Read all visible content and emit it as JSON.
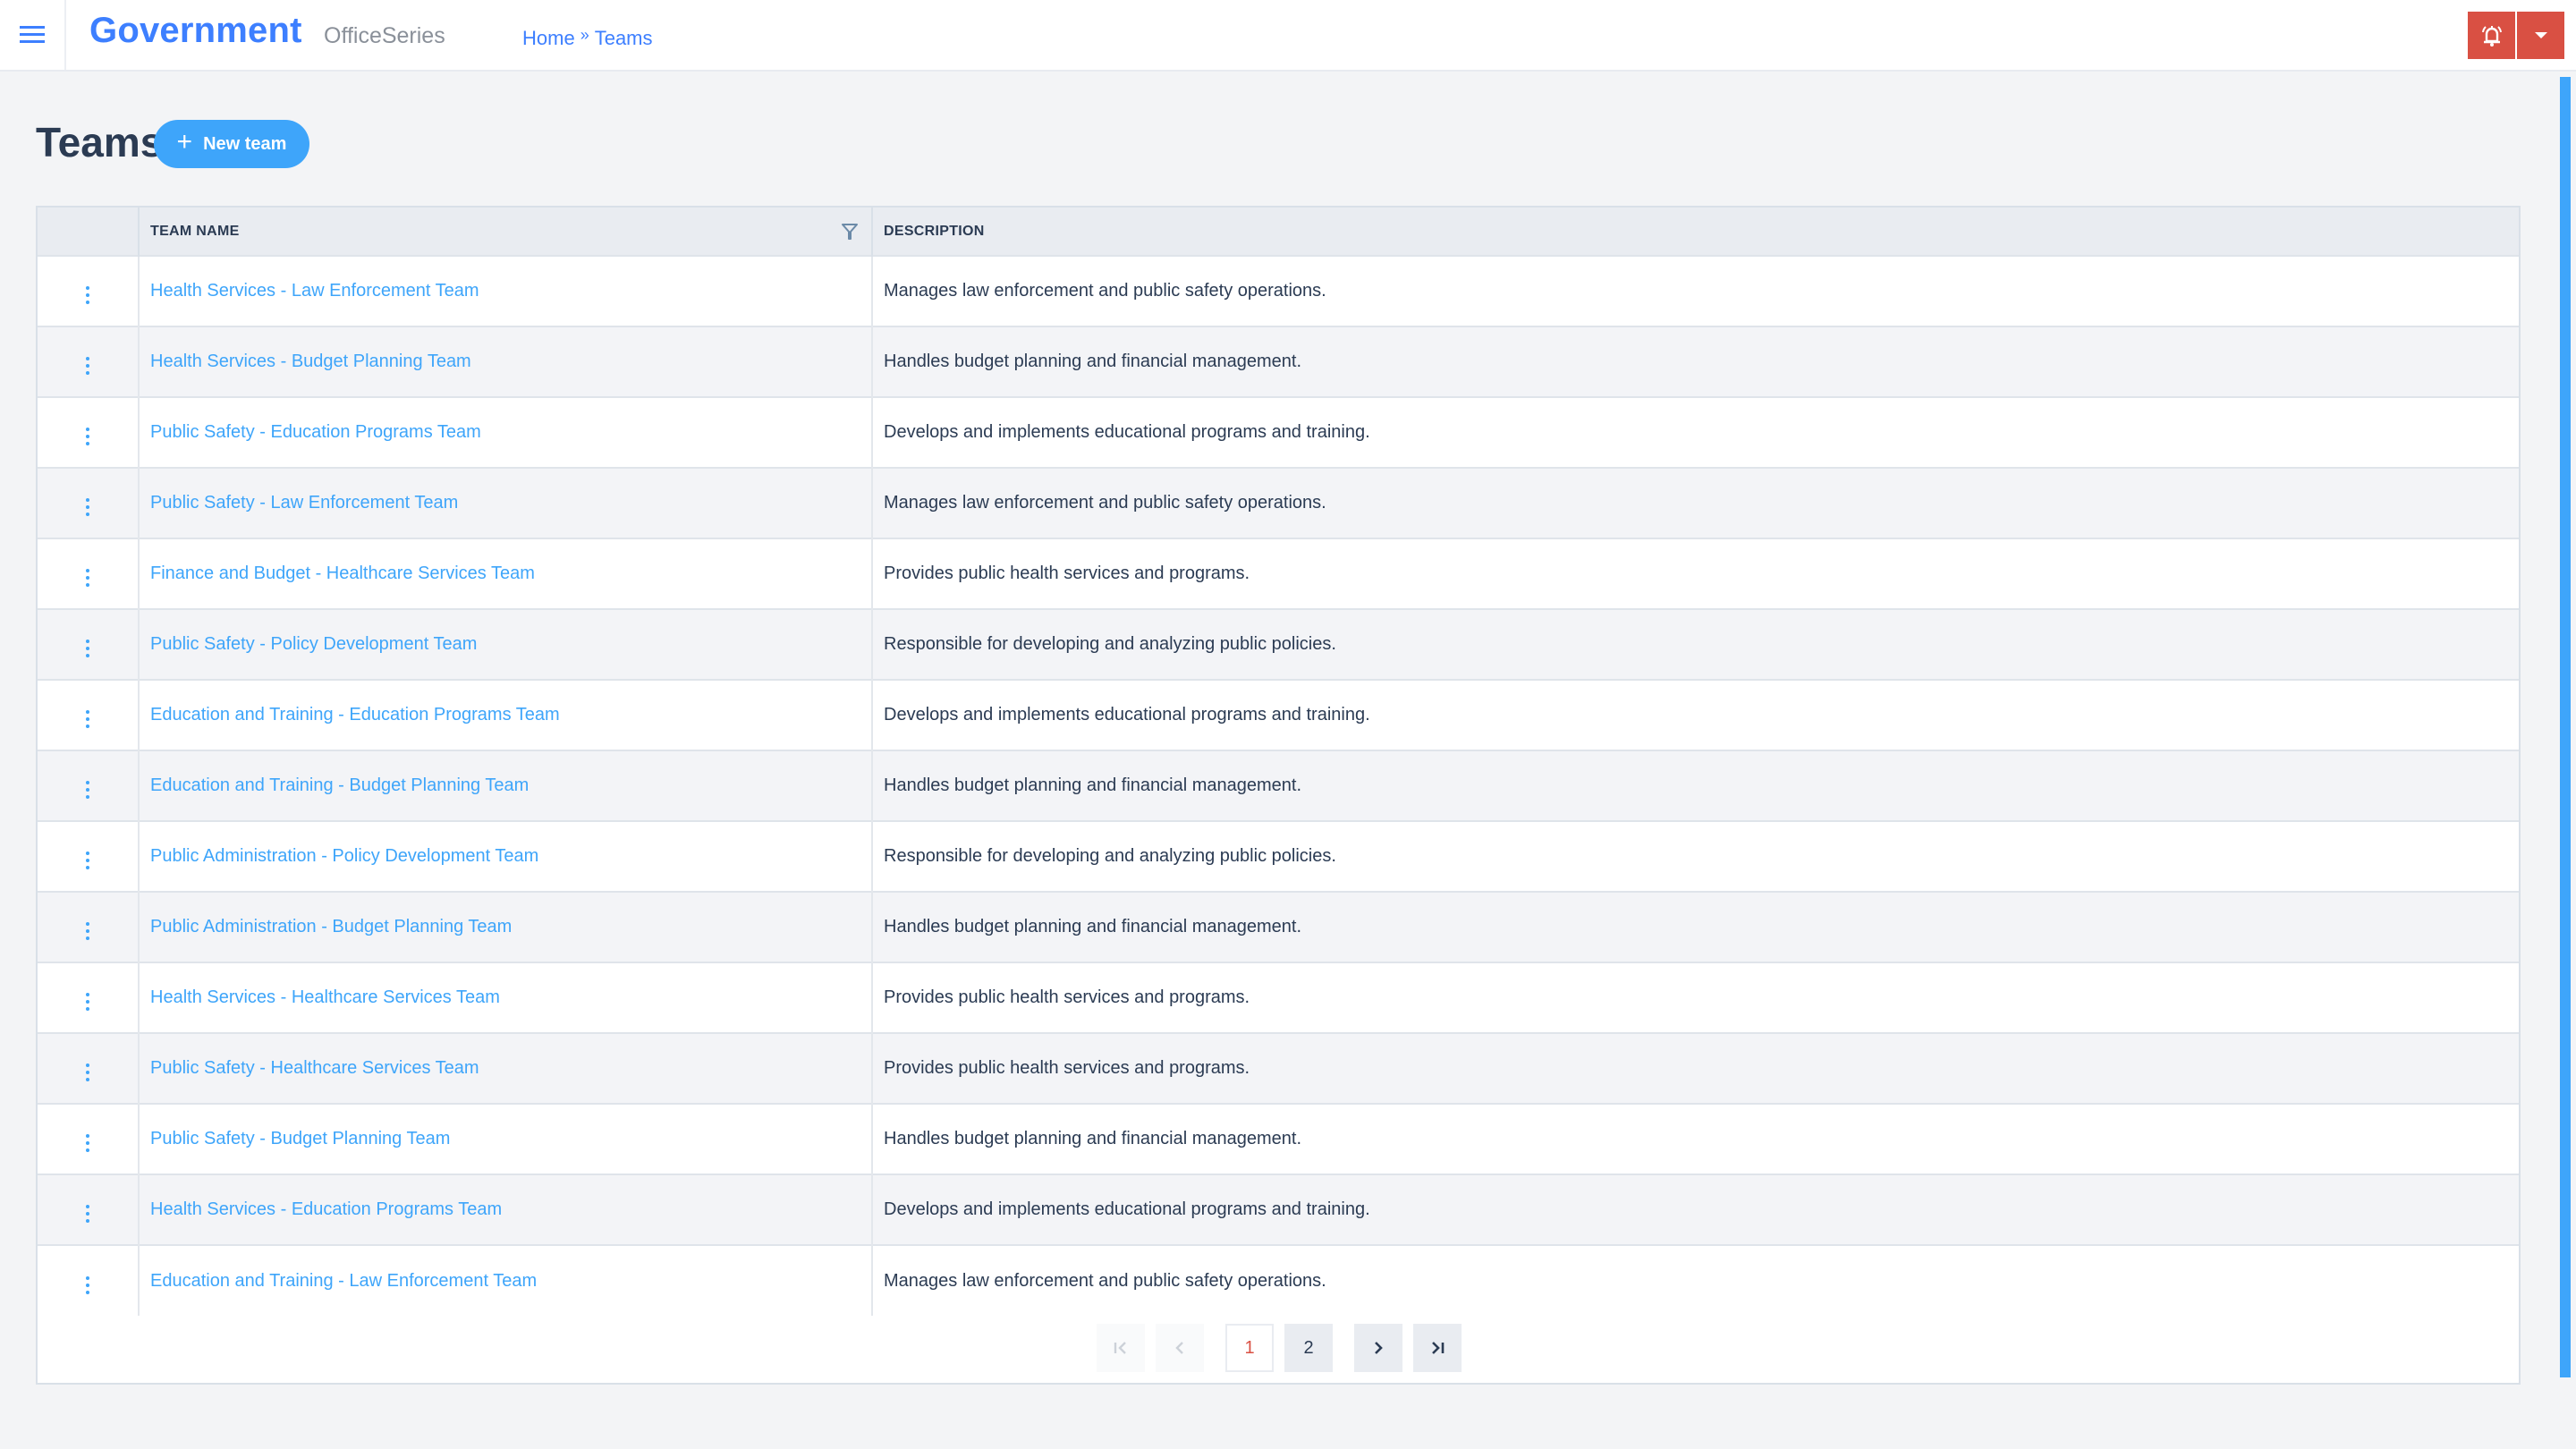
{
  "header": {
    "brand": "Government",
    "product": "OfficeSeries",
    "breadcrumb": [
      {
        "label": "Home"
      },
      {
        "label": "Teams"
      }
    ],
    "breadcrumb_separator": "»",
    "icons": {
      "menu": "hamburger-menu-icon",
      "alert": "bell-ringing-icon",
      "dropdown": "caret-down-icon"
    },
    "accent_color": "#3d7fff",
    "alert_color": "#d95043"
  },
  "page": {
    "title": "Teams",
    "new_button": {
      "label": "New team",
      "icon": "plus-icon"
    }
  },
  "table": {
    "columns": [
      {
        "key": "actions",
        "label": ""
      },
      {
        "key": "name",
        "label": "TEAM NAME",
        "filterable": true
      },
      {
        "key": "description",
        "label": "DESCRIPTION"
      }
    ],
    "rows": [
      {
        "name": "Health Services - Law Enforcement Team",
        "description": "Manages law enforcement and public safety operations."
      },
      {
        "name": "Health Services - Budget Planning Team",
        "description": "Handles budget planning and financial management."
      },
      {
        "name": "Public Safety - Education Programs Team",
        "description": "Develops and implements educational programs and training."
      },
      {
        "name": "Public Safety - Law Enforcement Team",
        "description": "Manages law enforcement and public safety operations."
      },
      {
        "name": "Finance and Budget - Healthcare Services Team",
        "description": "Provides public health services and programs."
      },
      {
        "name": "Public Safety - Policy Development Team",
        "description": "Responsible for developing and analyzing public policies."
      },
      {
        "name": "Education and Training - Education Programs Team",
        "description": "Develops and implements educational programs and training."
      },
      {
        "name": "Education and Training - Budget Planning Team",
        "description": "Handles budget planning and financial management."
      },
      {
        "name": "Public Administration - Policy Development Team",
        "description": "Responsible for developing and analyzing public policies."
      },
      {
        "name": "Public Administration - Budget Planning Team",
        "description": "Handles budget planning and financial management."
      },
      {
        "name": "Health Services - Healthcare Services Team",
        "description": "Provides public health services and programs."
      },
      {
        "name": "Public Safety - Healthcare Services Team",
        "description": "Provides public health services and programs."
      },
      {
        "name": "Public Safety - Budget Planning Team",
        "description": "Handles budget planning and financial management."
      },
      {
        "name": "Health Services - Education Programs Team",
        "description": "Develops and implements educational programs and training."
      },
      {
        "name": "Education and Training - Law Enforcement Team",
        "description": "Manages law enforcement and public safety operations."
      }
    ]
  },
  "pagination": {
    "first": {
      "glyph": "|<",
      "disabled": true
    },
    "prev": {
      "glyph": "<",
      "disabled": true
    },
    "pages": [
      {
        "label": "1",
        "active": true
      },
      {
        "label": "2",
        "active": false
      }
    ],
    "next": {
      "glyph": ">",
      "disabled": false
    },
    "last": {
      "glyph": ">|",
      "disabled": false
    }
  }
}
